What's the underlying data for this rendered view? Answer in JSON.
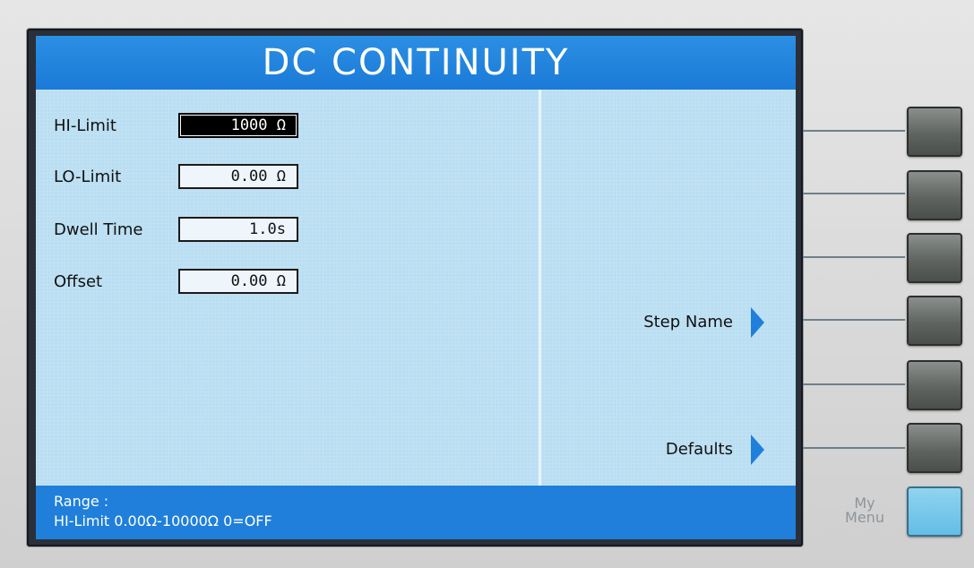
{
  "screen": {
    "title": "DC CONTINUITY",
    "fields": [
      {
        "label": "HI-Limit",
        "value": "1000 Ω",
        "selected": true
      },
      {
        "label": "LO-Limit",
        "value": "0.00 Ω",
        "selected": false
      },
      {
        "label": "Dwell Time",
        "value": "1.0s",
        "selected": false
      },
      {
        "label": "Offset",
        "value": "0.00 Ω",
        "selected": false
      }
    ],
    "softkeys": [
      {
        "label": "Step Name",
        "icon": "arrow-right-icon"
      },
      {
        "label": "Defaults",
        "icon": "arrow-right-icon"
      }
    ],
    "status": {
      "line1": "Range :",
      "line2": "HI-Limit 0.00Ω-10000Ω 0=OFF"
    }
  },
  "hardware": {
    "menu_label_line1": "My",
    "menu_label_line2": "Menu"
  },
  "colors": {
    "accent_blue": "#1f7fdb",
    "screen_bg": "#b9def2",
    "menu_key": "#63bde6"
  }
}
